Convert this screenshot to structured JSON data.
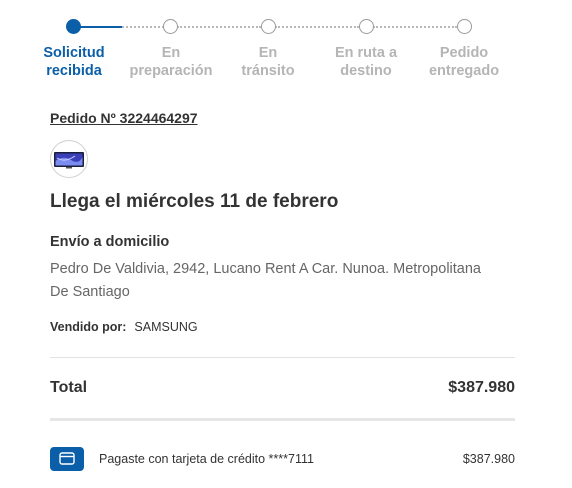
{
  "tracker": {
    "steps": [
      {
        "line1": "Solicitud",
        "line2": "recibida",
        "state": "done"
      },
      {
        "line1": "En",
        "line2": "preparación",
        "state": "pending"
      },
      {
        "line1": "En",
        "line2": "tránsito",
        "state": "pending"
      },
      {
        "line1": "En ruta a",
        "line2": "destino",
        "state": "pending"
      },
      {
        "line1": "Pedido",
        "line2": "entregado",
        "state": "pending"
      }
    ]
  },
  "order": {
    "number_label": "Pedido Nº 3224464297",
    "arrival_text": "Llega el miércoles 11 de febrero",
    "shipping": {
      "title": "Envío a domicilio",
      "address_line1": "Pedro De Valdivia, 2942, Lucano Rent A Car. Nunoa. Metropolitana",
      "address_line2": "De Santiago"
    },
    "seller": {
      "label": "Vendido por:",
      "name": "SAMSUNG"
    }
  },
  "summary": {
    "total_label": "Total",
    "total_value": "$387.980"
  },
  "payment": {
    "icon": "credit-card-icon",
    "text": "Pagaste con tarjeta de crédito ****7111",
    "amount": "$387.980"
  },
  "colors": {
    "accent": "#0b5fa8",
    "inactive": "#b5b5b5",
    "text": "#333333",
    "muted": "#666666"
  }
}
